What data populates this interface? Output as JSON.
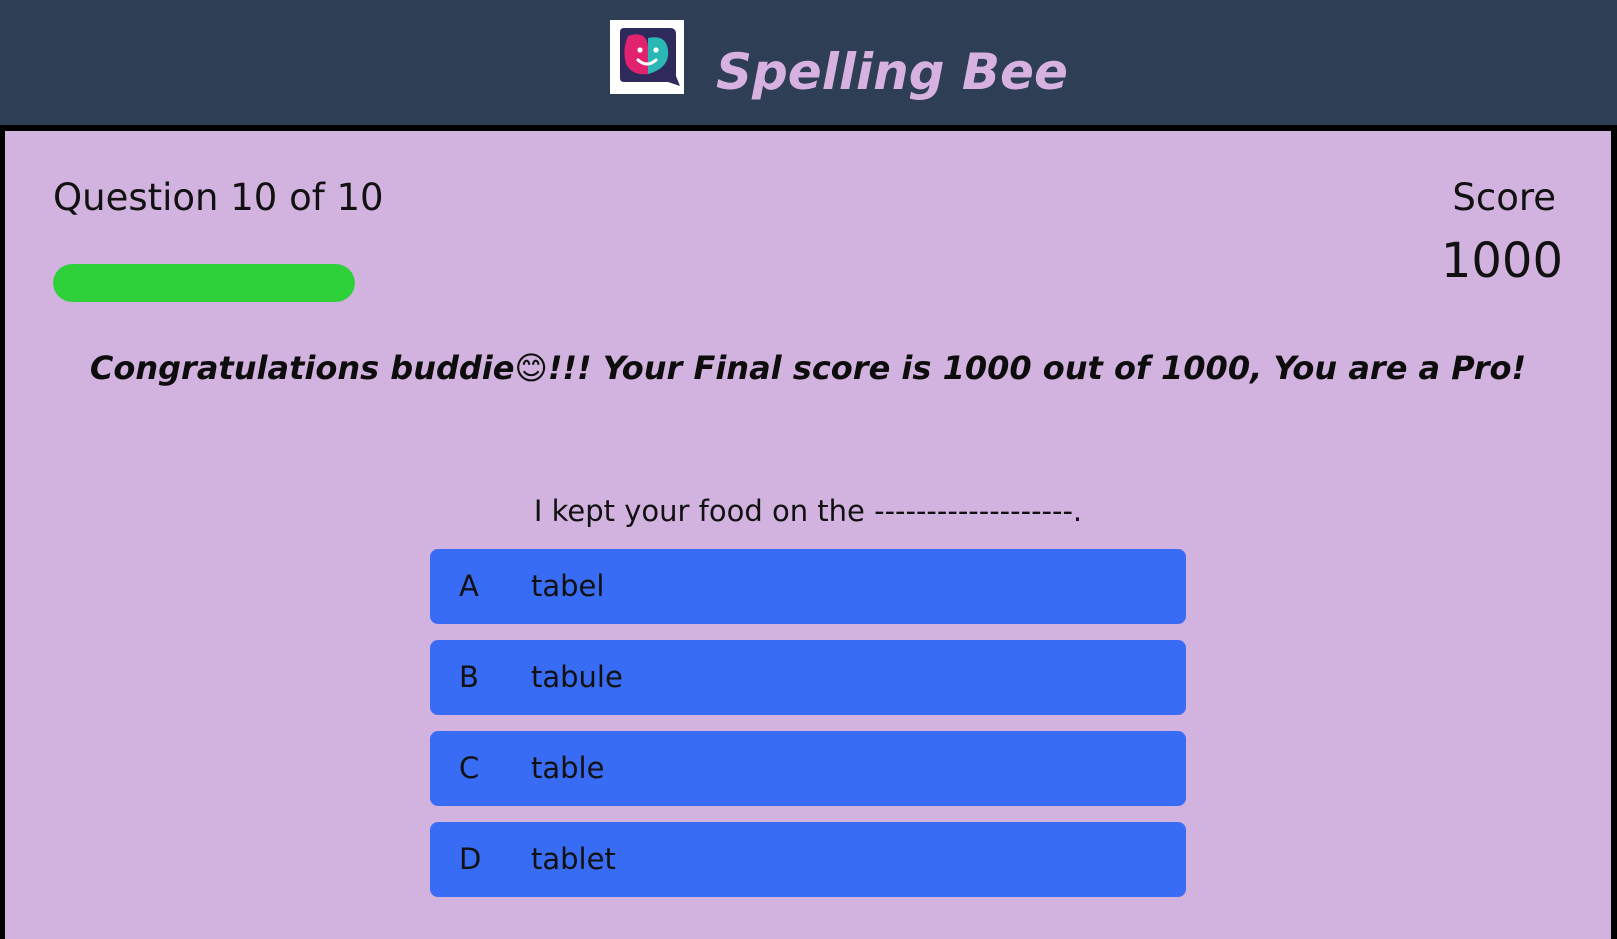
{
  "header": {
    "title": "Spelling Bee",
    "logo_icon": "chat-faces-logo-icon"
  },
  "colors": {
    "header_bg": "#2e3e55",
    "panel_bg": "#d2b2de",
    "brand": "#d7b2e0",
    "progress": "#2ed13a",
    "option_bg": "#396cf5"
  },
  "quiz": {
    "question_counter": "Question 10 of 10",
    "progress_fraction": 1.0,
    "score_label": "Score",
    "score_value": "1000",
    "final_message": "Congratulations buddie😊!!! Your Final score is 1000 out of 1000, You are a Pro!",
    "question_text": "I kept your food on the -------------------.",
    "options": [
      {
        "letter": "A",
        "text": "tabel"
      },
      {
        "letter": "B",
        "text": "tabule"
      },
      {
        "letter": "C",
        "text": "table"
      },
      {
        "letter": "D",
        "text": "tablet"
      }
    ]
  }
}
